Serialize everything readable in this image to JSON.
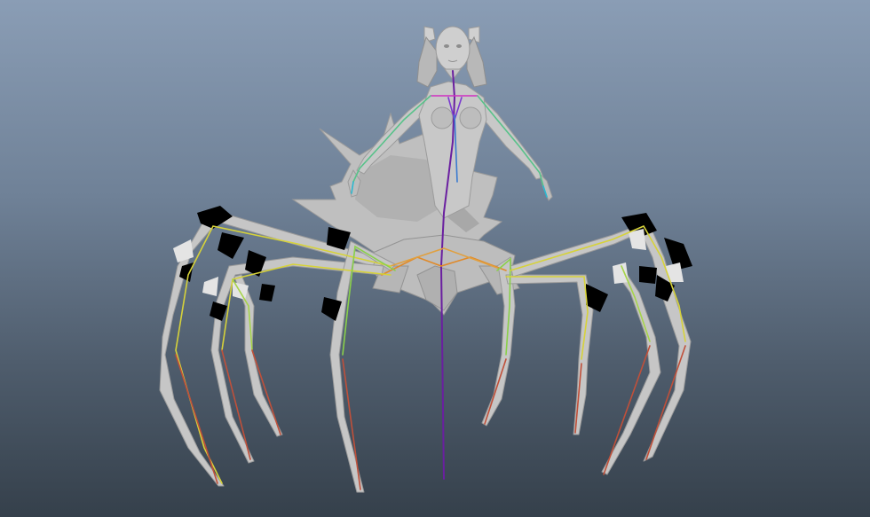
{
  "viewport": {
    "background_top": "#8a9db5",
    "background_bottom": "#35404b"
  },
  "model": {
    "mesh_color": "#c6c6c6",
    "mesh_shade": "#a7a7a7",
    "mesh_dark": "#8e8e8e",
    "artifact_color": "#000000"
  },
  "skeleton": {
    "spine_color": "#6a1fa0",
    "leg_joint_color": "#d6d23a",
    "hip_color": "#e08a2a",
    "arm_color": "#58c28a",
    "foot_color": "#c0503a",
    "head_color": "#d030c0"
  }
}
